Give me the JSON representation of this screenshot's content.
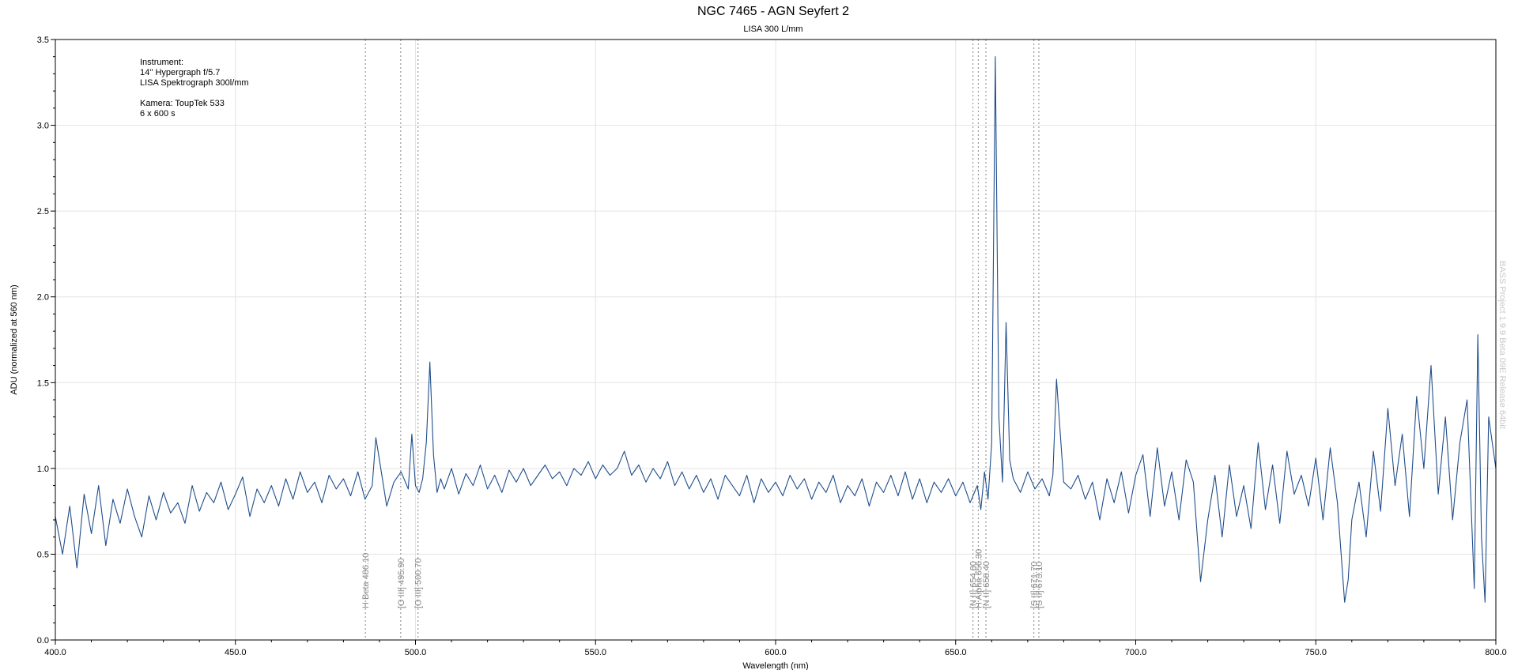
{
  "chart_data": {
    "type": "line",
    "title": "NGC 7465  -  AGN Seyfert 2",
    "subtitle": "LISA 300 L/mm",
    "xlabel": "Wavelength (nm)",
    "ylabel": "ADU (normalized at 560 nm)",
    "xlim": [
      400,
      800
    ],
    "ylim": [
      0,
      3.5
    ],
    "x_ticks": [
      "400.0",
      "450.0",
      "500.0",
      "550.0",
      "600.0",
      "650.0",
      "700.0",
      "750.0",
      "800.0"
    ],
    "y_ticks": [
      "0.0",
      "0.5",
      "1.0",
      "1.5",
      "2.0",
      "2.5",
      "3.0",
      "3.5"
    ],
    "grid": true,
    "colors": {
      "series": "#1f4e8c",
      "reference_lines": "#9a9a9a",
      "grid": "#e4e4e4"
    },
    "annotation_lines": [
      "Instrument:",
      "14'' Hypergraph f/5.7",
      "LISA Spektrograph 300l/mm",
      "",
      "Kamera: ToupTek 533",
      "6  x 600 s"
    ],
    "reference_lines": [
      {
        "x": 486.1,
        "label": "H Beta 486.10"
      },
      {
        "x": 495.9,
        "label": "[O III] 495.90"
      },
      {
        "x": 500.7,
        "label": "[O III] 500.70"
      },
      {
        "x": 654.8,
        "label": "[N II] 654.80"
      },
      {
        "x": 656.3,
        "label": "H Alpha 656.30"
      },
      {
        "x": 658.4,
        "label": "[N II] 658.40"
      },
      {
        "x": 671.7,
        "label": "[S II] 671.70"
      },
      {
        "x": 673.1,
        "label": "[S II] 673.10"
      }
    ],
    "watermark": "BASS Project 1.9.9 Beta 09E Release 64bit",
    "series": [
      {
        "x": [
          400,
          402,
          404,
          406,
          408,
          410,
          412,
          414,
          416,
          418,
          420,
          422,
          424,
          426,
          428,
          430,
          432,
          434,
          436,
          438,
          440,
          442,
          444,
          446,
          448,
          450,
          452,
          454,
          456,
          458,
          460,
          462,
          464,
          466,
          468,
          470,
          472,
          474,
          476,
          478,
          480,
          482,
          484,
          486,
          488,
          489,
          490,
          492,
          494,
          496,
          498,
          499,
          500,
          501,
          502,
          503,
          504,
          505,
          506,
          507,
          508,
          510,
          512,
          514,
          516,
          518,
          520,
          522,
          524,
          526,
          528,
          530,
          532,
          534,
          536,
          538,
          540,
          542,
          544,
          546,
          548,
          550,
          552,
          554,
          556,
          558,
          560,
          562,
          564,
          566,
          568,
          570,
          572,
          574,
          576,
          578,
          580,
          582,
          584,
          586,
          588,
          590,
          592,
          594,
          596,
          598,
          600,
          602,
          604,
          606,
          608,
          610,
          612,
          614,
          616,
          618,
          620,
          622,
          624,
          626,
          628,
          630,
          632,
          634,
          636,
          638,
          640,
          642,
          644,
          646,
          648,
          650,
          652,
          654,
          656,
          657,
          658,
          659,
          660,
          661,
          662,
          663,
          664,
          665,
          666,
          668,
          670,
          672,
          674,
          676,
          677,
          678,
          679,
          680,
          682,
          684,
          686,
          688,
          690,
          692,
          694,
          696,
          698,
          700,
          702,
          704,
          706,
          708,
          710,
          712,
          714,
          716,
          718,
          720,
          722,
          724,
          726,
          728,
          730,
          732,
          734,
          736,
          738,
          740,
          742,
          744,
          746,
          748,
          750,
          752,
          754,
          756,
          758,
          759,
          760,
          762,
          764,
          766,
          768,
          770,
          772,
          774,
          776,
          778,
          780,
          782,
          784,
          786,
          788,
          790,
          792,
          794,
          795,
          796,
          797,
          798,
          800
        ],
        "y": [
          0.72,
          0.5,
          0.78,
          0.42,
          0.85,
          0.62,
          0.9,
          0.55,
          0.82,
          0.68,
          0.88,
          0.72,
          0.6,
          0.84,
          0.7,
          0.86,
          0.74,
          0.8,
          0.68,
          0.9,
          0.75,
          0.86,
          0.8,
          0.92,
          0.76,
          0.85,
          0.95,
          0.72,
          0.88,
          0.8,
          0.9,
          0.78,
          0.94,
          0.82,
          0.98,
          0.86,
          0.92,
          0.8,
          0.96,
          0.88,
          0.94,
          0.84,
          0.98,
          0.82,
          0.9,
          1.18,
          1.05,
          0.78,
          0.92,
          0.98,
          0.88,
          1.2,
          0.9,
          0.86,
          0.94,
          1.15,
          1.62,
          1.08,
          0.86,
          0.94,
          0.88,
          1.0,
          0.85,
          0.97,
          0.9,
          1.02,
          0.88,
          0.96,
          0.86,
          0.99,
          0.92,
          1.0,
          0.9,
          0.96,
          1.02,
          0.94,
          0.98,
          0.9,
          1.0,
          0.96,
          1.04,
          0.94,
          1.02,
          0.96,
          1.0,
          1.1,
          0.96,
          1.02,
          0.92,
          1.0,
          0.94,
          1.04,
          0.9,
          0.98,
          0.88,
          0.96,
          0.86,
          0.94,
          0.82,
          0.96,
          0.9,
          0.84,
          0.96,
          0.8,
          0.94,
          0.86,
          0.92,
          0.84,
          0.96,
          0.88,
          0.94,
          0.82,
          0.92,
          0.86,
          0.96,
          0.8,
          0.9,
          0.84,
          0.94,
          0.78,
          0.92,
          0.86,
          0.96,
          0.84,
          0.98,
          0.82,
          0.94,
          0.8,
          0.92,
          0.86,
          0.94,
          0.84,
          0.92,
          0.8,
          0.9,
          0.76,
          0.98,
          0.82,
          1.15,
          3.4,
          1.3,
          0.92,
          1.85,
          1.05,
          0.94,
          0.86,
          0.98,
          0.88,
          0.94,
          0.84,
          0.96,
          1.52,
          1.22,
          0.92,
          0.88,
          0.96,
          0.82,
          0.92,
          0.7,
          0.94,
          0.8,
          0.98,
          0.74,
          0.96,
          1.08,
          0.72,
          1.12,
          0.78,
          0.98,
          0.7,
          1.05,
          0.92,
          0.34,
          0.7,
          0.96,
          0.6,
          1.02,
          0.72,
          0.9,
          0.65,
          1.15,
          0.76,
          1.02,
          0.68,
          1.1,
          0.85,
          0.96,
          0.78,
          1.06,
          0.7,
          1.12,
          0.8,
          0.22,
          0.35,
          0.7,
          0.92,
          0.6,
          1.1,
          0.75,
          1.35,
          0.9,
          1.2,
          0.72,
          1.42,
          1.0,
          1.6,
          0.85,
          1.3,
          0.7,
          1.15,
          1.4,
          0.3,
          1.78,
          0.6,
          0.22,
          1.3,
          1.0
        ]
      }
    ]
  }
}
